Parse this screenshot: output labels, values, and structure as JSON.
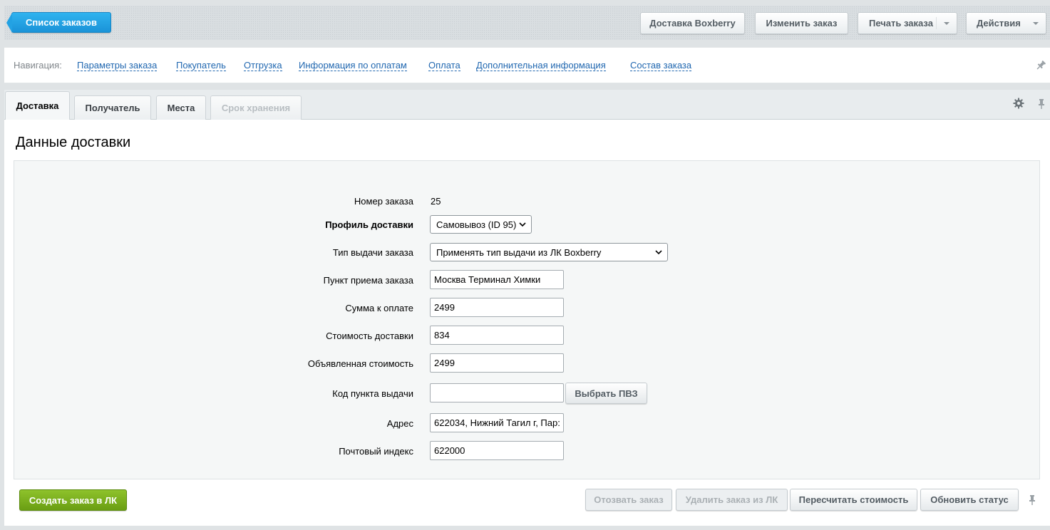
{
  "toolbar": {
    "back_label": "Список заказов",
    "buttons": [
      {
        "label": "Доставка Boxberry"
      },
      {
        "label": "Изменить заказ"
      },
      {
        "label": "Печать заказа"
      },
      {
        "label": "Действия"
      }
    ]
  },
  "navigation": {
    "label": "Навигация:",
    "links": [
      "Параметры заказа",
      "Покупатель",
      "Отгрузка",
      "Информация по оплатам",
      "Оплата",
      "Дополнительная информация",
      "Состав заказа"
    ]
  },
  "tabs": [
    {
      "label": "Доставка",
      "state": "active"
    },
    {
      "label": "Получатель",
      "state": "normal"
    },
    {
      "label": "Места",
      "state": "normal"
    },
    {
      "label": "Срок хранения",
      "state": "disabled"
    }
  ],
  "section": {
    "title": "Данные доставки"
  },
  "form": {
    "order_number": {
      "label": "Номер заказа",
      "value": "25"
    },
    "delivery_profile": {
      "label": "Профиль доставки",
      "value": "Самовывоз (ID 95)"
    },
    "issue_type": {
      "label": "Тип выдачи заказа",
      "value": "Применять тип выдачи из ЛК Boxberry"
    },
    "reception_point": {
      "label": "Пункт приема заказа",
      "value": "Москва Терминал Химки"
    },
    "amount_to_pay": {
      "label": "Сумма к оплате",
      "value": "2499"
    },
    "delivery_cost": {
      "label": "Стоимость доставки",
      "value": "834"
    },
    "declared_value": {
      "label": "Объявленная стоимость",
      "value": "2499"
    },
    "pickup_code": {
      "label": "Код пункта выдачи",
      "value": "",
      "button": "Выбрать ПВЗ"
    },
    "address": {
      "label": "Адрес",
      "value": "622034, Нижний Тагил г, Пар:"
    },
    "postcode": {
      "label": "Почтовый индекс",
      "value": "622000"
    }
  },
  "footer": {
    "create_label": "Создать заказ в ЛК",
    "recall_label": "Отозвать заказ",
    "delete_label": "Удалить заказ из ЛК",
    "recalc_label": "Пересчитать стоимость",
    "update_label": "Обновить статус"
  }
}
